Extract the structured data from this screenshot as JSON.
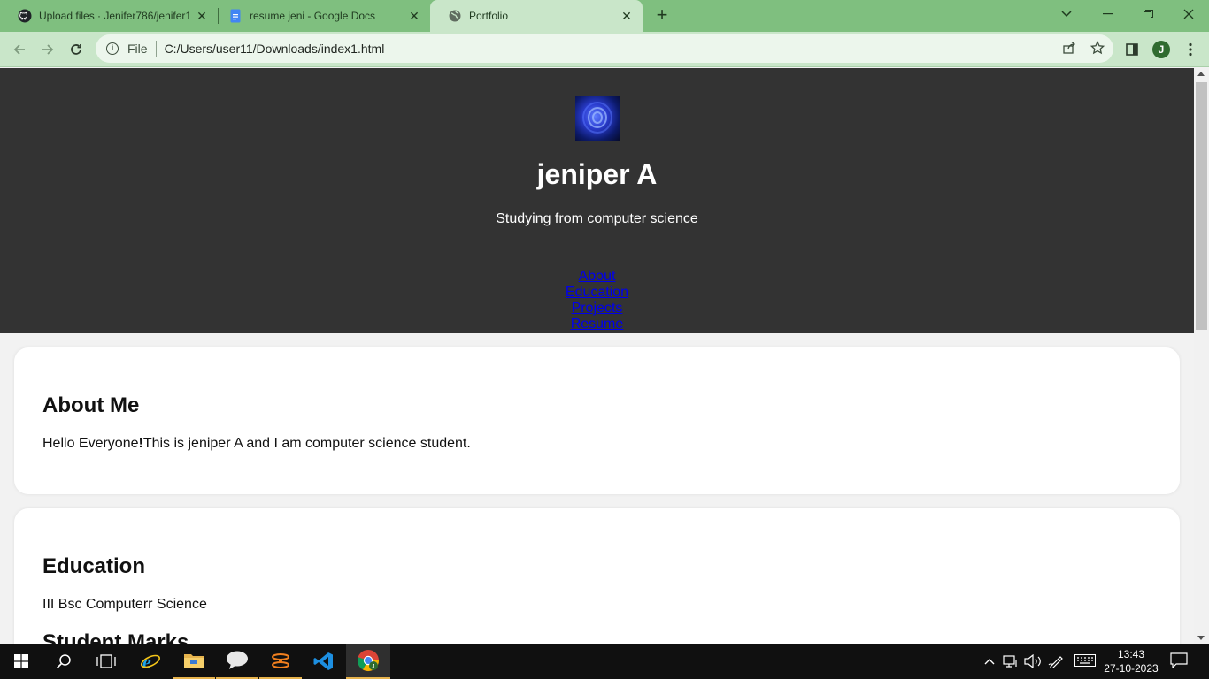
{
  "browser": {
    "tabs": [
      {
        "title": "Upload files · Jenifer786/jenifer1",
        "icon": "github-icon",
        "active": false
      },
      {
        "title": "resume jeni - Google Docs",
        "icon": "google-docs-icon",
        "active": false
      },
      {
        "title": "Portfolio",
        "icon": "globe-icon",
        "active": true
      }
    ],
    "address": {
      "scheme_label": "File",
      "url": "C:/Users/user11/Downloads/index1.html"
    },
    "profile_initial": "J",
    "colors": {
      "frame": "#7fbf7f",
      "toolbar": "#c9e6c9"
    }
  },
  "page": {
    "header": {
      "name": "jeniper A",
      "subtitle": "Studying from computer science",
      "nav": [
        "About",
        "Education",
        "Projects",
        "Resume"
      ],
      "background": "#333333"
    },
    "about": {
      "heading": "About Me",
      "text_before": "Hello Everyone",
      "text_bang": "!",
      "text_after": "This is jeniper A and I am computer science student."
    },
    "education": {
      "heading": "Education",
      "degree": "III Bsc Computerr Science",
      "subheading": "Student Marks"
    }
  },
  "taskbar": {
    "time": "13:43",
    "date": "27-10-2023",
    "pinned": [
      "windows-start-icon",
      "search-icon",
      "task-view-icon",
      "internet-explorer-icon",
      "file-explorer-icon",
      "chat-icon",
      "java-icon",
      "vscode-icon",
      "chrome-icon"
    ]
  }
}
